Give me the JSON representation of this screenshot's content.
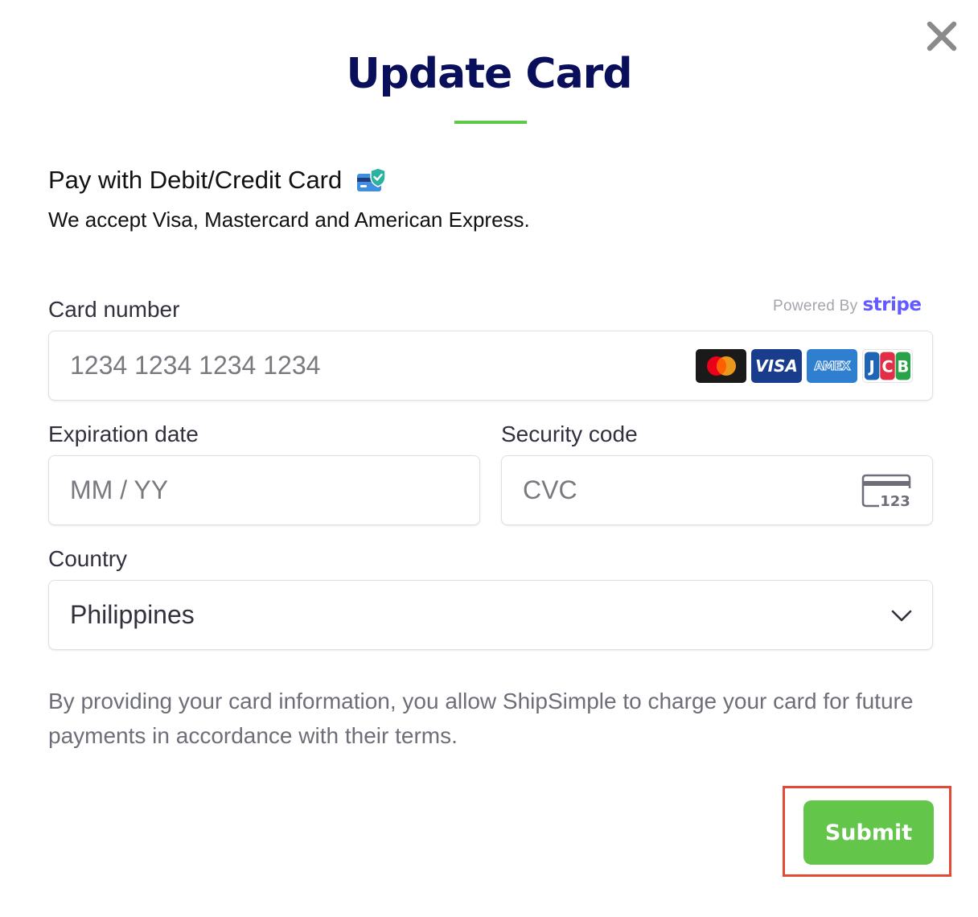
{
  "dialog": {
    "title": "Update Card",
    "close_icon": "close-icon"
  },
  "colors": {
    "title": "#0a0f5c",
    "accent_green": "#5ec84a",
    "submit_button": "#63c64b",
    "stripe_purple": "#635bff",
    "highlight_red": "#e34a35"
  },
  "payment": {
    "heading": "Pay with Debit/Credit Card",
    "heading_icon": "card-shield-icon",
    "accepted_text": "We accept Visa, Mastercard and American Express."
  },
  "powered_by": {
    "prefix": "Powered By",
    "brand": "stripe"
  },
  "card_number": {
    "label": "Card number",
    "placeholder": "1234 1234 1234 1234",
    "brands": [
      {
        "name": "mastercard-icon"
      },
      {
        "name": "visa-icon",
        "text": "VISA"
      },
      {
        "name": "amex-icon",
        "text": "AMEX"
      },
      {
        "name": "jcb-icon",
        "text": "JCB"
      }
    ]
  },
  "expiration": {
    "label": "Expiration date",
    "placeholder": "MM / YY"
  },
  "security_code": {
    "label": "Security code",
    "placeholder": "CVC",
    "icon_text": "123"
  },
  "country": {
    "label": "Country",
    "value": "Philippines"
  },
  "terms_text": "By providing your card information, you allow ShipSimple to charge your card for future payments in accordance with their terms.",
  "submit_label": "Submit"
}
